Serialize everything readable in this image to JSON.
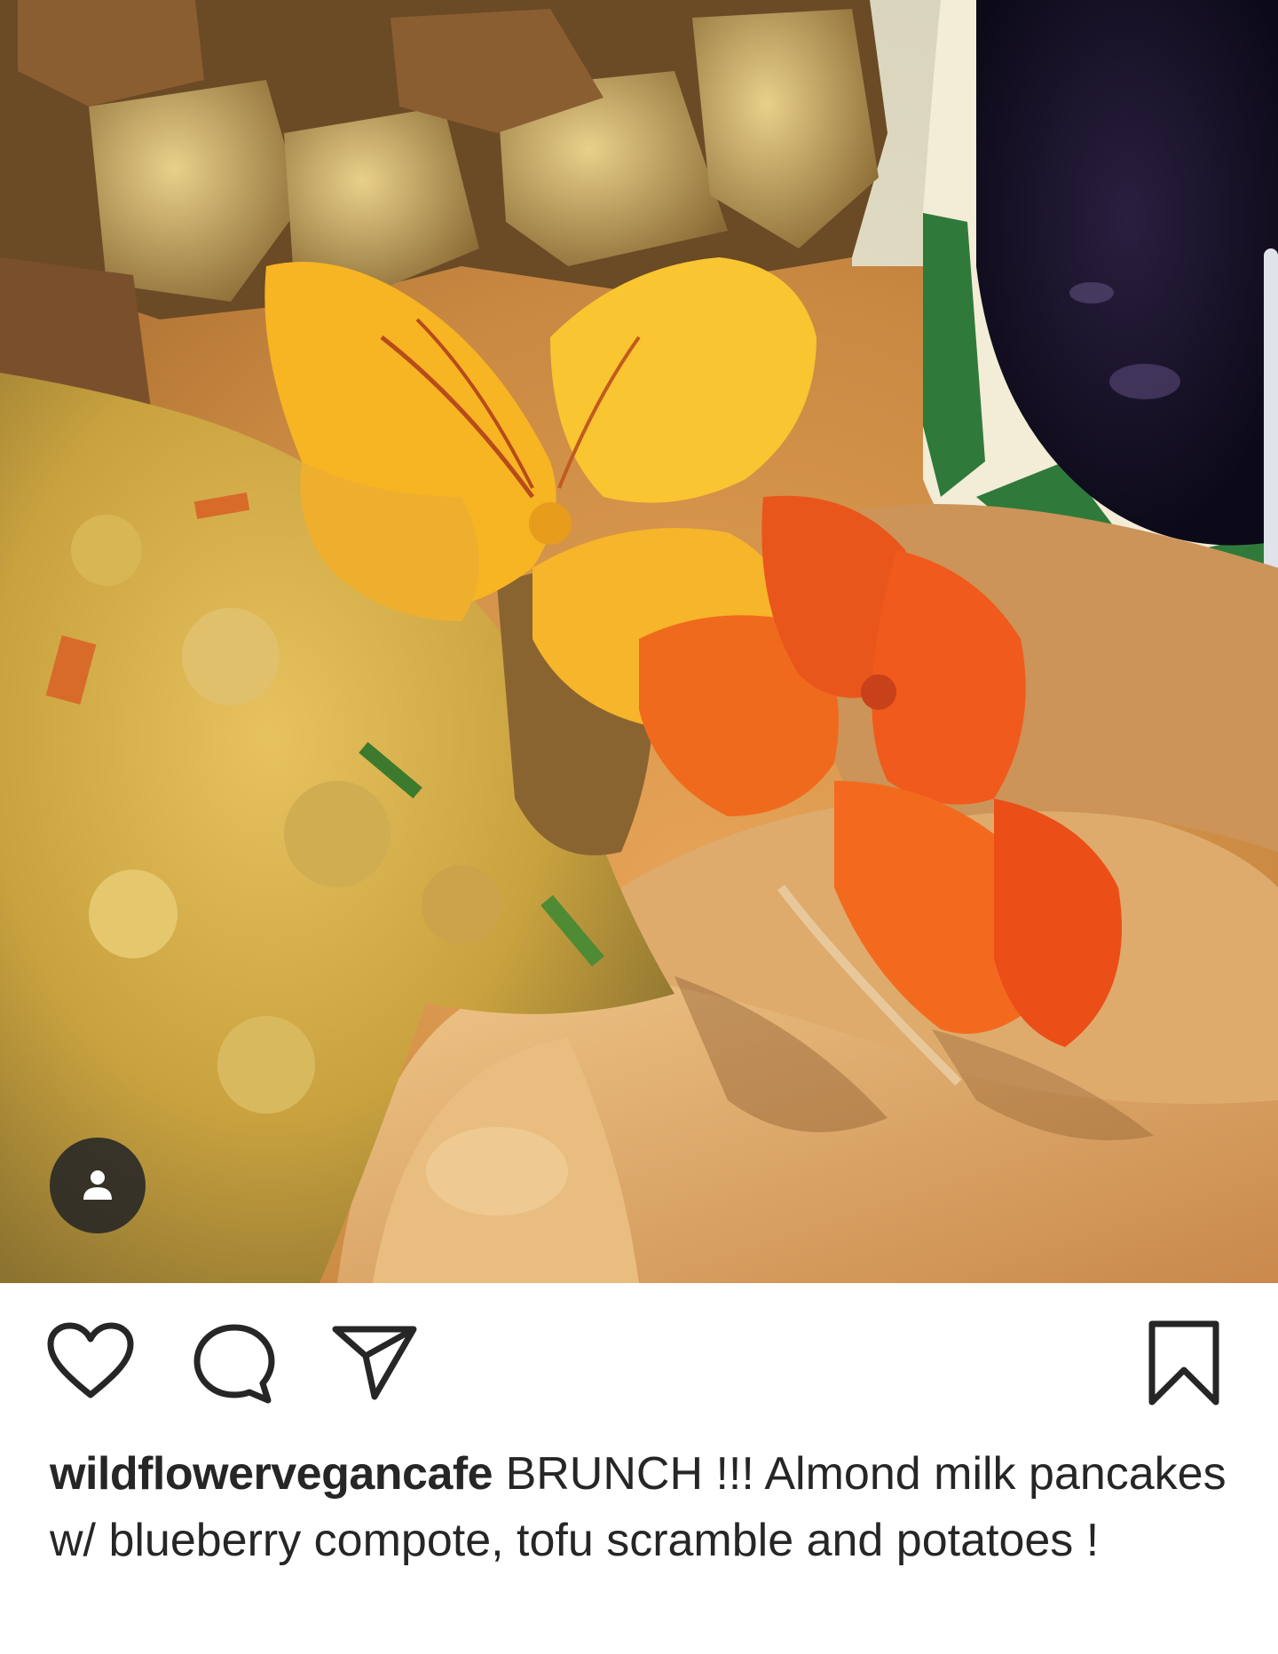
{
  "post": {
    "image": {
      "alt_description": "",
      "tag_icon": "person-icon"
    },
    "actions": {
      "like_icon": "heart-icon",
      "comment_icon": "comment-bubble-icon",
      "share_icon": "paper-plane-icon",
      "save_icon": "bookmark-icon"
    },
    "caption": {
      "username": "wildflowervegancafe",
      "text": "BRUNCH !!! Almond milk pancakes w/ blueberry compote, tofu scramble and potatoes !"
    }
  },
  "colors": {
    "text": "#262626",
    "icon_stroke": "#262626",
    "background": "#ffffff"
  }
}
